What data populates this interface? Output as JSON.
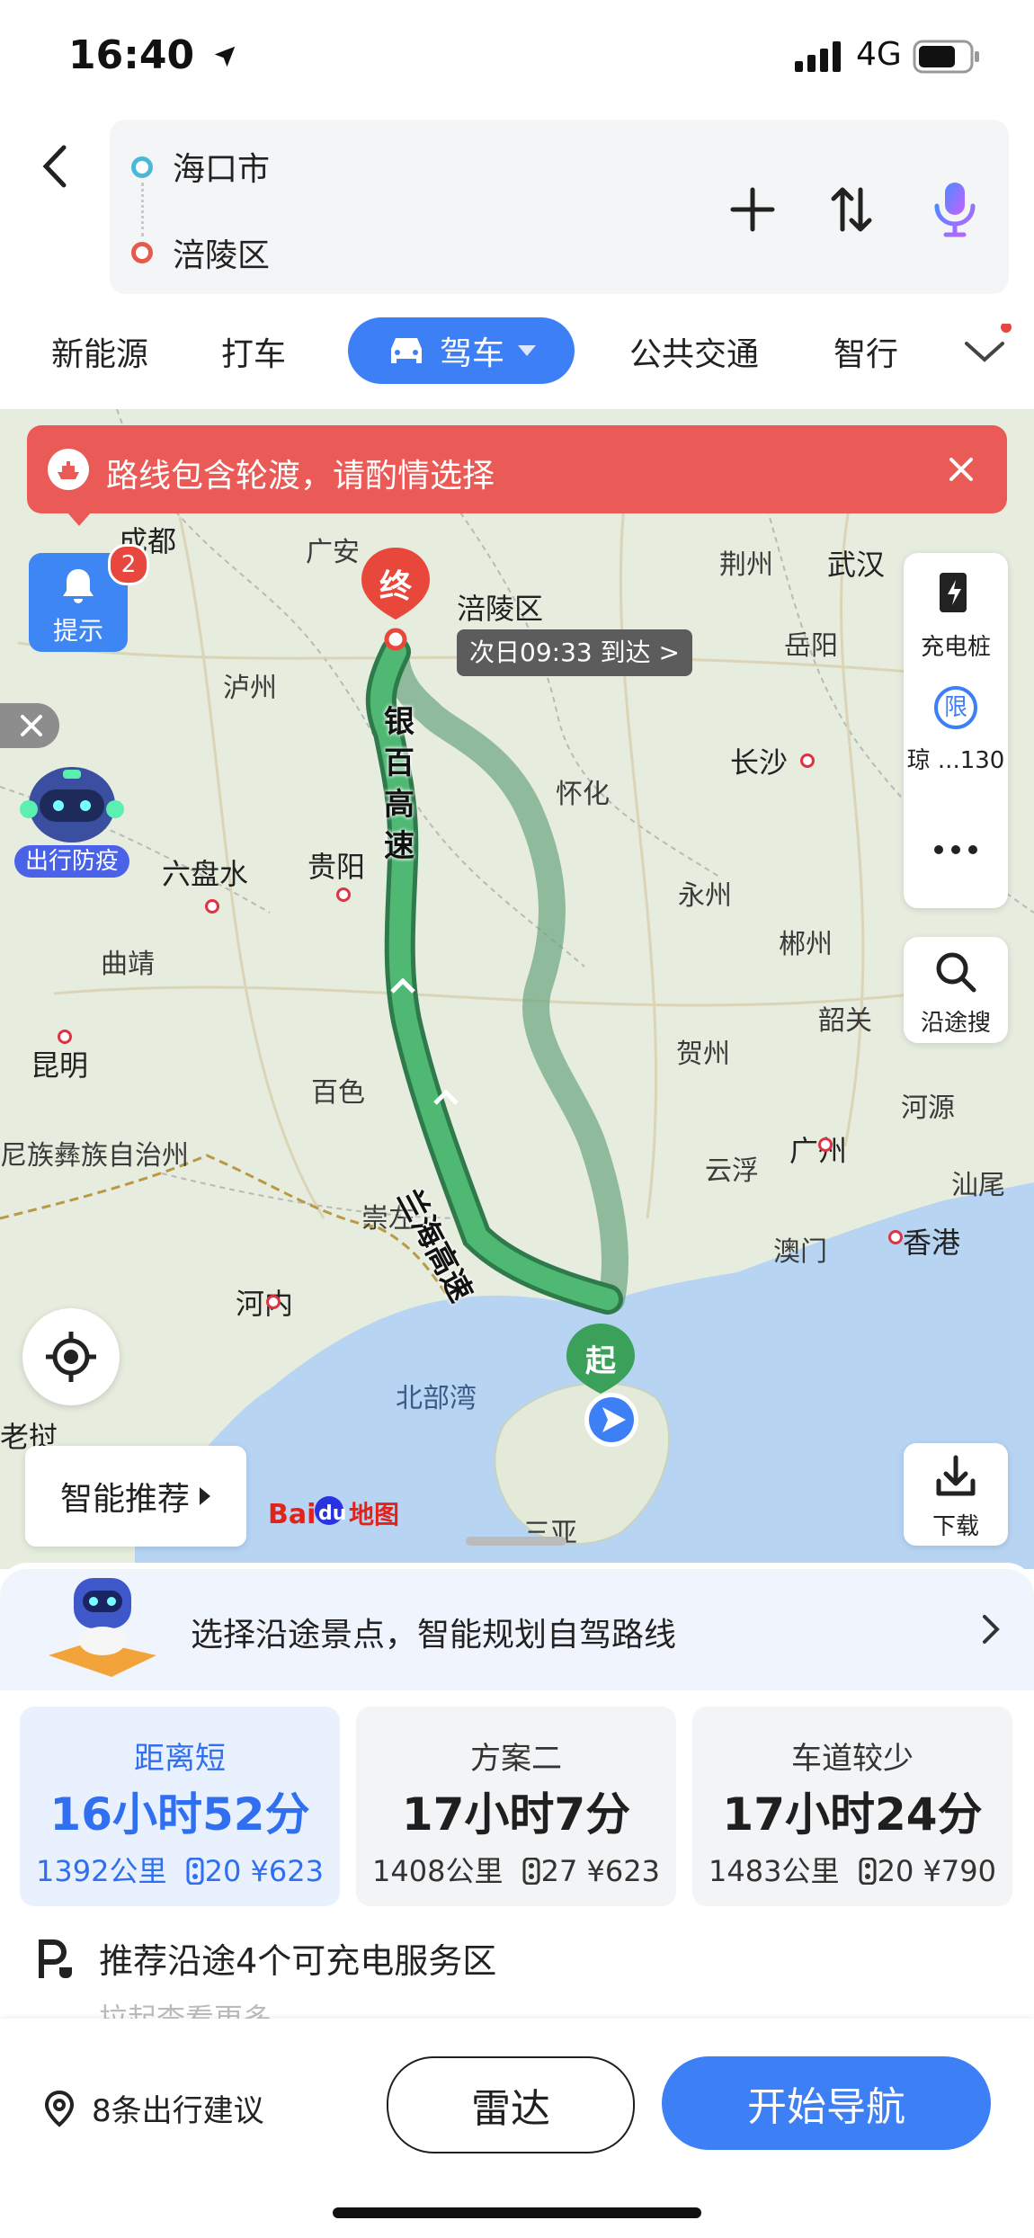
{
  "status_bar": {
    "time": "16:40",
    "network": "4G"
  },
  "header": {
    "origin": "海口市",
    "destination": "涪陵区"
  },
  "mode_tabs": {
    "new_energy": "新能源",
    "taxi": "打车",
    "drive": "驾车",
    "transit": "公共交通",
    "smart": "智行"
  },
  "map": {
    "ferry_banner": "路线包含轮渡，请酌情选择",
    "tip_label": "提示",
    "tip_count": "2",
    "epidemic_label": "出行防疫",
    "end_marker": "终",
    "start_marker": "起",
    "destination_label": "涪陵区",
    "arrival": "次日09:33 到达 >",
    "tools": {
      "charging": "充电桩",
      "restriction_icon": "限",
      "restriction": "琼 ...130",
      "along_search": "沿途搜",
      "download": "下载"
    },
    "smart_recommend": "智能推荐",
    "road_labels": {
      "yinbai": "银百高速",
      "lanhai": "兰海高速"
    },
    "logo_text": "Baidu地图",
    "places": [
      "成都",
      "广安",
      "泸州",
      "六盘水",
      "贵阳",
      "曲靖",
      "昆明",
      "怀化",
      "长沙",
      "永州",
      "郴州",
      "韶关",
      "河源",
      "广州",
      "云浮",
      "贺州",
      "百色",
      "崇左",
      "河内",
      "北部湾",
      "荆州",
      "武汉",
      "岳阳",
      "澳门",
      "香港",
      "汕尾",
      "三亚",
      "老挝",
      "尼族彝族自治州"
    ]
  },
  "sheet": {
    "promo": "选择沿途景点，智能规划自驾路线",
    "routes": [
      {
        "name": "距离短",
        "time": "16小时52分",
        "distance": "1392公里",
        "lights": "20",
        "cost": "¥623"
      },
      {
        "name": "方案二",
        "time": "17小时7分",
        "distance": "1408公里",
        "lights": "27",
        "cost": "¥623"
      },
      {
        "name": "车道较少",
        "time": "17小时24分",
        "distance": "1483公里",
        "lights": "20",
        "cost": "¥790"
      }
    ],
    "service_area": "推荐沿途4个可充电服务区",
    "pull_hint": "拉起查看更多"
  },
  "bottom_bar": {
    "tips": "8条出行建议",
    "radar": "雷达",
    "navigate": "开始导航"
  },
  "colors": {
    "accent": "#3d7ff5",
    "route_main": "#3aa05a",
    "route_alt": "#8cc8a4",
    "banner": "#ea5a56"
  }
}
